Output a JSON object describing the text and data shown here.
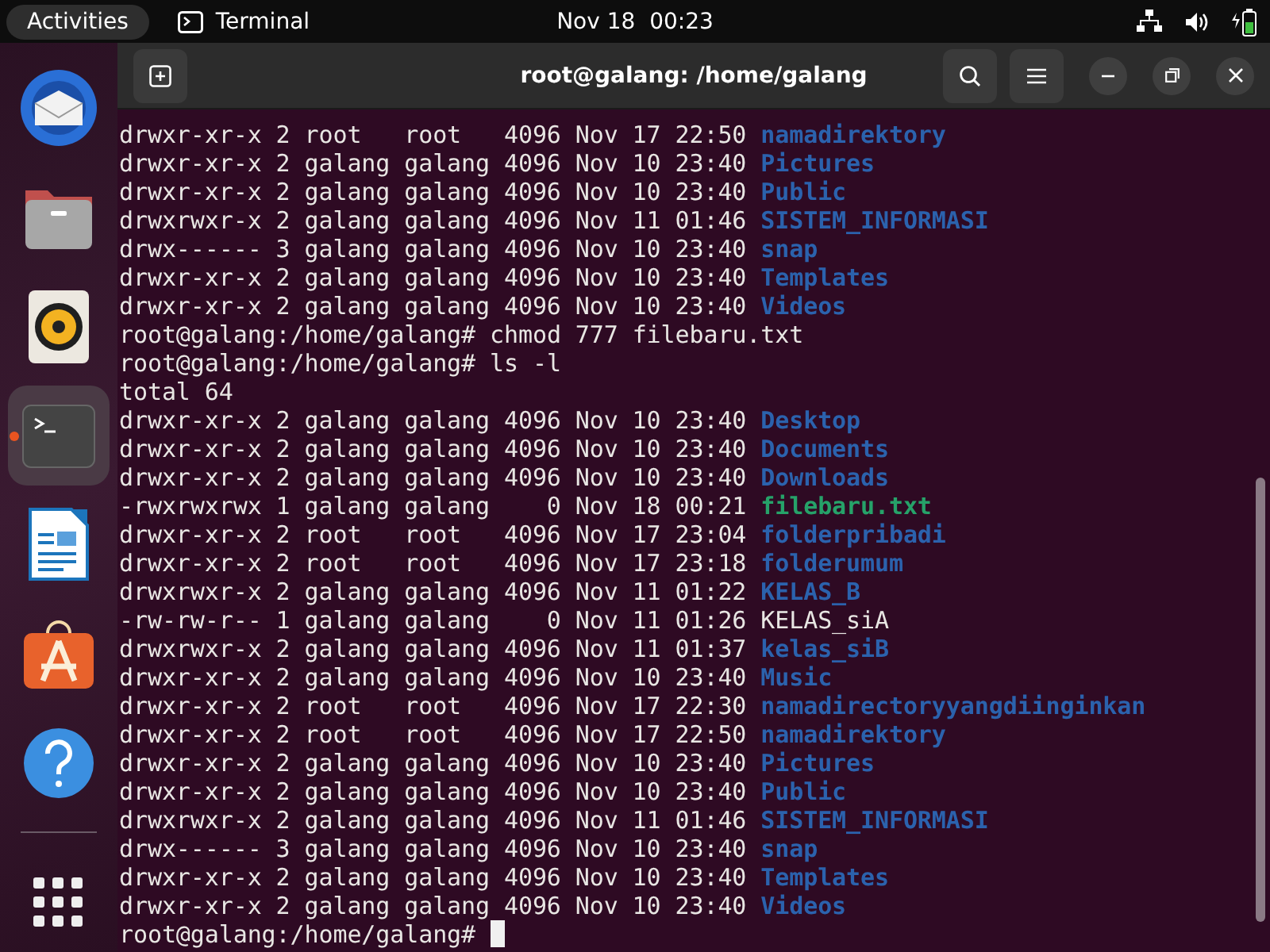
{
  "top_bar": {
    "activities": "Activities",
    "app_name": "Terminal",
    "clock": "Nov 18  00:23"
  },
  "dock": [
    {
      "kind": "mail",
      "active": false
    },
    {
      "kind": "files",
      "active": false
    },
    {
      "kind": "music",
      "active": false
    },
    {
      "kind": "terminal",
      "active": true
    },
    {
      "kind": "writer",
      "active": false
    },
    {
      "kind": "store",
      "active": false
    },
    {
      "kind": "help",
      "active": false
    },
    {
      "kind": "apps",
      "active": false
    }
  ],
  "window": {
    "title": "root@galang: /home/galang"
  },
  "terminal": {
    "lines": [
      {
        "kind": "dir",
        "info": "drwxr-xr-x 2 root   root   4096 Nov 17 22:50 ",
        "name": "namadirektory"
      },
      {
        "kind": "dir",
        "info": "drwxr-xr-x 2 galang galang 4096 Nov 10 23:40 ",
        "name": "Pictures"
      },
      {
        "kind": "dir",
        "info": "drwxr-xr-x 2 galang galang 4096 Nov 10 23:40 ",
        "name": "Public"
      },
      {
        "kind": "dir",
        "info": "drwxrwxr-x 2 galang galang 4096 Nov 11 01:46 ",
        "name": "SISTEM_INFORMASI"
      },
      {
        "kind": "dir",
        "info": "drwx------ 3 galang galang 4096 Nov 10 23:40 ",
        "name": "snap"
      },
      {
        "kind": "dir",
        "info": "drwxr-xr-x 2 galang galang 4096 Nov 10 23:40 ",
        "name": "Templates"
      },
      {
        "kind": "dir",
        "info": "drwxr-xr-x 2 galang galang 4096 Nov 10 23:40 ",
        "name": "Videos"
      },
      {
        "kind": "prompt",
        "prompt": "root@galang:/home/galang# ",
        "command": "chmod 777 filebaru.txt"
      },
      {
        "kind": "prompt",
        "prompt": "root@galang:/home/galang# ",
        "command": "ls -l"
      },
      {
        "kind": "output",
        "text": "total 64"
      },
      {
        "kind": "dir",
        "info": "drwxr-xr-x 2 galang galang 4096 Nov 10 23:40 ",
        "name": "Desktop"
      },
      {
        "kind": "dir",
        "info": "drwxr-xr-x 2 galang galang 4096 Nov 10 23:40 ",
        "name": "Documents"
      },
      {
        "kind": "dir",
        "info": "drwxr-xr-x 2 galang galang 4096 Nov 10 23:40 ",
        "name": "Downloads"
      },
      {
        "kind": "exec",
        "info": "-rwxrwxrwx 1 galang galang    0 Nov 18 00:21 ",
        "name": "filebaru.txt"
      },
      {
        "kind": "dir",
        "info": "drwxr-xr-x 2 root   root   4096 Nov 17 23:04 ",
        "name": "folderpribadi"
      },
      {
        "kind": "dir",
        "info": "drwxr-xr-x 2 root   root   4096 Nov 17 23:18 ",
        "name": "folderumum"
      },
      {
        "kind": "dir",
        "info": "drwxrwxr-x 2 galang galang 4096 Nov 11 01:22 ",
        "name": "KELAS_B"
      },
      {
        "kind": "file",
        "info": "-rw-rw-r-- 1 galang galang    0 Nov 11 01:26 ",
        "name": "KELAS_siA"
      },
      {
        "kind": "dir",
        "info": "drwxrwxr-x 2 galang galang 4096 Nov 11 01:37 ",
        "name": "kelas_siB"
      },
      {
        "kind": "dir",
        "info": "drwxr-xr-x 2 galang galang 4096 Nov 10 23:40 ",
        "name": "Music"
      },
      {
        "kind": "dir",
        "info": "drwxr-xr-x 2 root   root   4096 Nov 17 22:30 ",
        "name": "namadirectoryyangdiinginkan"
      },
      {
        "kind": "dir",
        "info": "drwxr-xr-x 2 root   root   4096 Nov 17 22:50 ",
        "name": "namadirektory"
      },
      {
        "kind": "dir",
        "info": "drwxr-xr-x 2 galang galang 4096 Nov 10 23:40 ",
        "name": "Pictures"
      },
      {
        "kind": "dir",
        "info": "drwxr-xr-x 2 galang galang 4096 Nov 10 23:40 ",
        "name": "Public"
      },
      {
        "kind": "dir",
        "info": "drwxrwxr-x 2 galang galang 4096 Nov 11 01:46 ",
        "name": "SISTEM_INFORMASI"
      },
      {
        "kind": "dir",
        "info": "drwx------ 3 galang galang 4096 Nov 10 23:40 ",
        "name": "snap"
      },
      {
        "kind": "dir",
        "info": "drwxr-xr-x 2 galang galang 4096 Nov 10 23:40 ",
        "name": "Templates"
      },
      {
        "kind": "dir",
        "info": "drwxr-xr-x 2 galang galang 4096 Nov 10 23:40 ",
        "name": "Videos"
      },
      {
        "kind": "prompt",
        "prompt": "root@galang:/home/galang# ",
        "cursor": true
      }
    ]
  }
}
